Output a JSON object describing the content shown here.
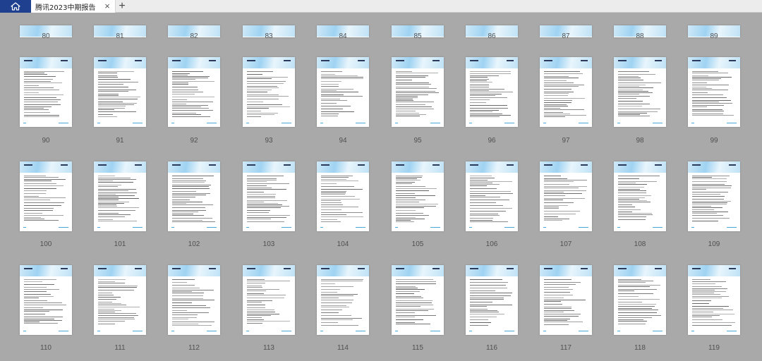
{
  "tabbar": {
    "home_icon": "home-icon",
    "tab_title": "腾讯2023中期报告",
    "close_label": "×",
    "new_tab_label": "+"
  },
  "rows": [
    [
      "80",
      "81",
      "82",
      "83",
      "84",
      "85",
      "86",
      "87",
      "88",
      "89"
    ],
    [
      "90",
      "91",
      "92",
      "93",
      "94",
      "95",
      "96",
      "97",
      "98",
      "99"
    ],
    [
      "100",
      "101",
      "102",
      "103",
      "104",
      "105",
      "106",
      "107",
      "108",
      "109"
    ],
    [
      "110",
      "111",
      "112",
      "113",
      "114",
      "115",
      "116",
      "117",
      "118",
      "119"
    ]
  ]
}
